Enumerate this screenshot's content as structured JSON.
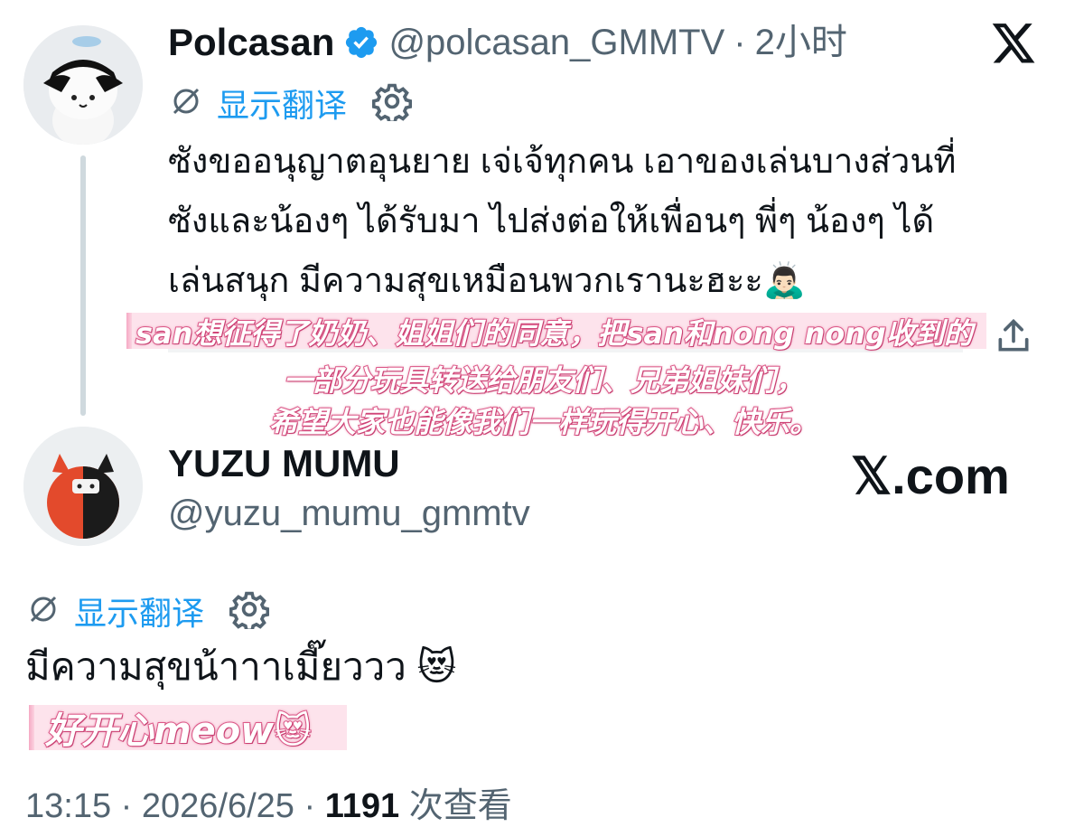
{
  "tweet1": {
    "author_name": "Polcasan",
    "author_handle": "@polcasan_GMMTV",
    "separator": "·",
    "time_ago": "2小时",
    "translate_label": "显示翻译",
    "text_lines": [
      "ซังขออนุญาตอุนยาย เจ่เจ้ทุกคน เอาของเล่นบางส่วนที่",
      "ซังและน้องๆ ได้รับมา ไปส่งต่อให้เพื่อนๆ พี่ๆ น้องๆ ได้",
      "เล่นสนุก มีความสุขเหมือนพวกเรานะฮะะ"
    ],
    "emoji": "🙇🏻‍♂️",
    "subtitle_lines": [
      "san想征得了奶奶、姐姐们的同意，把san和nong nong收到的",
      "一部分玩具转送给朋友们、兄弟姐妹们，",
      "希望大家也能像我们一样玩得开心、快乐。"
    ]
  },
  "tweet2": {
    "author_name": "YUZU MUMU",
    "author_handle": "@yuzu_mumu_gmmtv",
    "translate_label": "显示翻译",
    "text": "มีความสุขน้าาาเมี๊ยววว",
    "emoji": "😻",
    "subtitle": "好开心meow😻"
  },
  "watermark": "𝕏.com",
  "footer": {
    "time": "13:15",
    "sep1": "·",
    "date": "2026/6/25",
    "sep2": "·",
    "views": "1191",
    "views_label": "次查看"
  },
  "icons": [
    "x-logo-icon",
    "verified-badge-icon",
    "translate-icon",
    "gear-icon",
    "share-icon"
  ],
  "colors": {
    "link": "#1d9bf0",
    "muted": "#536471",
    "verified": "#1d9bf0",
    "subtitle_stroke": "#e0608e"
  }
}
